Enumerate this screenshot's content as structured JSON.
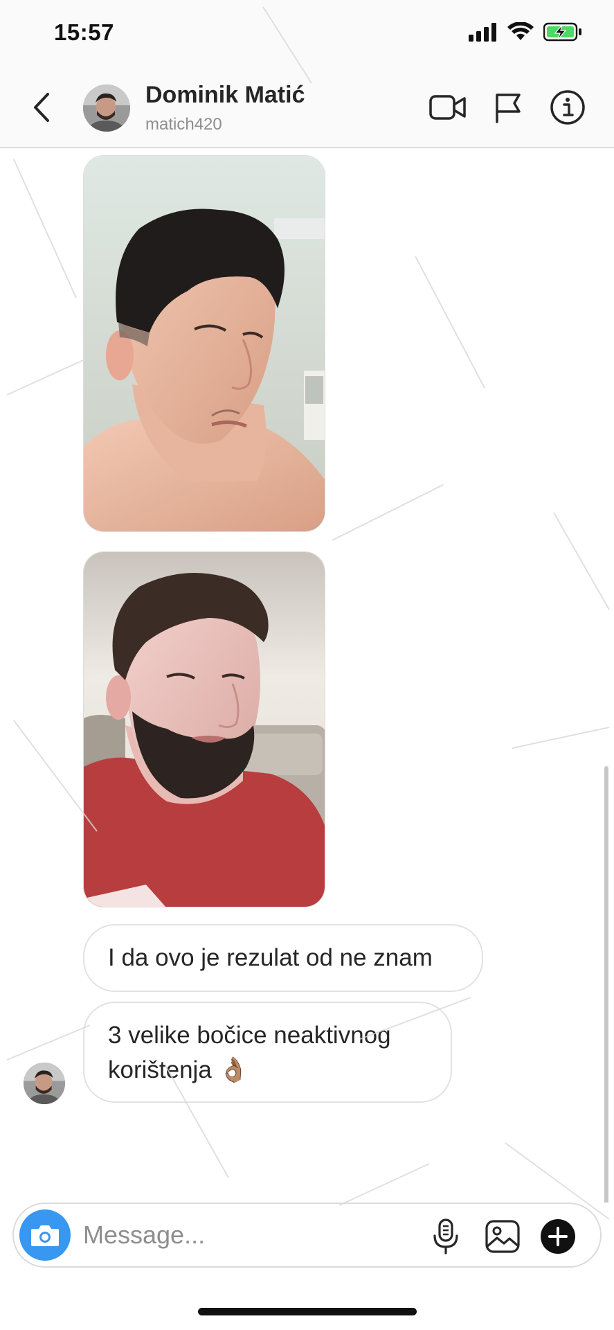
{
  "status_bar": {
    "time": "15:57",
    "icons": [
      "signal-icon",
      "wifi-icon",
      "battery-charging-icon"
    ]
  },
  "header": {
    "back_icon": "chevron-left-icon",
    "name": "Dominik Matić",
    "username": "matich420",
    "actions": [
      "video-call-icon",
      "flag-icon",
      "info-icon"
    ]
  },
  "messages": [
    {
      "type": "photo",
      "description_icon": "photo-message"
    },
    {
      "type": "photo",
      "description_icon": "photo-message"
    },
    {
      "type": "text",
      "text": "I da ovo je rezulat od ne znam"
    },
    {
      "type": "text",
      "line1": "3 velike bočice neaktivnog",
      "line2": "korištenja 👌🏽"
    }
  ],
  "composer": {
    "placeholder": "Message...",
    "icons": [
      "camera-icon",
      "microphone-icon",
      "gallery-icon",
      "plus-icon"
    ]
  },
  "colors": {
    "accent": "#3897f0",
    "battery": "#4cd964",
    "text": "#262626",
    "muted": "#8e8e8e"
  }
}
